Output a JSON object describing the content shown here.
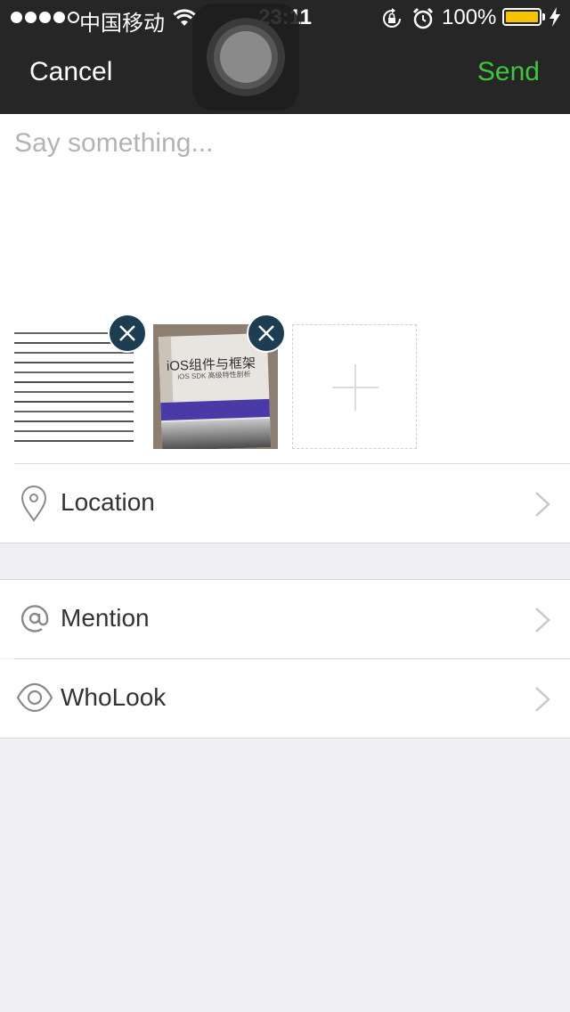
{
  "status_bar": {
    "carrier": "中国移动",
    "time": "23:11",
    "battery_percent": "100%",
    "signal_bars_filled": 4,
    "signal_bars_total": 5,
    "battery_color": "#f5c300",
    "icons": [
      "wifi-icon",
      "rotation-lock-icon",
      "alarm-icon",
      "battery-icon",
      "charging-bolt-icon"
    ]
  },
  "nav": {
    "cancel_label": "Cancel",
    "send_label": "Send",
    "send_color": "#3cc63c"
  },
  "compose": {
    "placeholder": "Say something...",
    "value": ""
  },
  "attachments": {
    "images": [
      {
        "name": "text-document-photo",
        "removable": true
      },
      {
        "name": "book-cover-photo",
        "book_title": "iOS组件与框架",
        "book_subtitle": "iOS SDK 高级特性剖析",
        "removable": true
      }
    ],
    "add_icon": "plus-icon",
    "remove_icon": "close-icon"
  },
  "options": {
    "location": {
      "label": "Location",
      "icon": "location-pin-icon"
    },
    "mention": {
      "label": "Mention",
      "icon": "at-sign-icon"
    },
    "wholook": {
      "label": "WhoLook",
      "icon": "eye-icon"
    }
  }
}
